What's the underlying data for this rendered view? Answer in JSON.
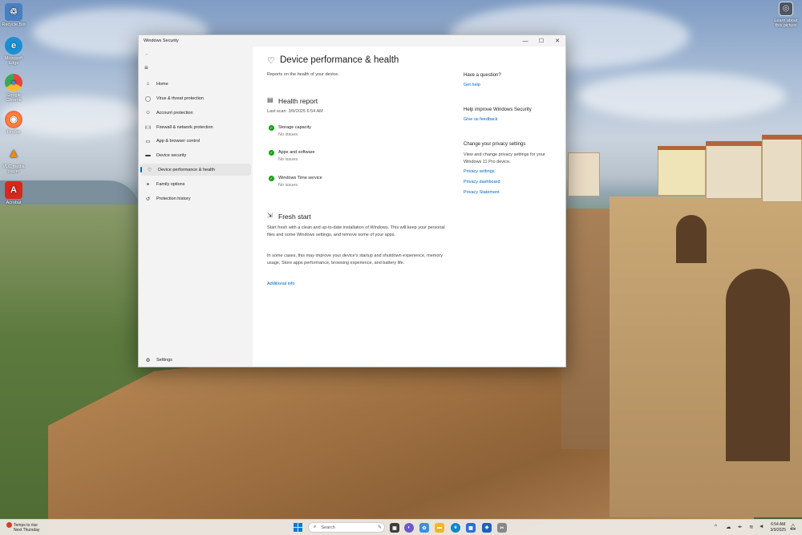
{
  "desktop": {
    "icons": [
      {
        "label": "Recycle Bin",
        "glyph": "♲",
        "color": "#4a7fbf"
      },
      {
        "label": "Microsoft Edge",
        "glyph": "e",
        "color": "#1b8fd3"
      },
      {
        "label": "Google Chrome",
        "glyph": "●",
        "color": "#e8453c"
      },
      {
        "label": "Firefox",
        "glyph": "◉",
        "color": "#ff7139"
      },
      {
        "label": "VLC media player",
        "glyph": "▲",
        "color": "#f08a00"
      },
      {
        "label": "Acrobat",
        "glyph": "A",
        "color": "#d9271c"
      }
    ],
    "about_picture": {
      "label": "Learn about this picture",
      "icon": "camera-icon"
    }
  },
  "window": {
    "title": "Windows Security",
    "controls": {
      "minimize": "—",
      "maximize": "☐",
      "close": "✕"
    }
  },
  "sidebar": {
    "back": "←",
    "menu": "≡",
    "items": [
      {
        "label": "Home",
        "icon": "⌂"
      },
      {
        "label": "Virus & threat protection",
        "icon": "◯"
      },
      {
        "label": "Account protection",
        "icon": "☺"
      },
      {
        "label": "Firewall & network protection",
        "icon": "((·))"
      },
      {
        "label": "App & browser control",
        "icon": "▭"
      },
      {
        "label": "Device security",
        "icon": "▬"
      },
      {
        "label": "Device performance & health",
        "icon": "♡"
      },
      {
        "label": "Family options",
        "icon": "⚭"
      },
      {
        "label": "Protection history",
        "icon": "↺"
      }
    ],
    "active_index": 6,
    "settings": {
      "label": "Settings",
      "icon": "⚙"
    }
  },
  "main": {
    "title": "Device performance & health",
    "subtitle": "Reports on the health of your device.",
    "health_report": {
      "title": "Health report",
      "last_scan": "Last scan: 3/9/2025 6:54 AM",
      "items": [
        {
          "title": "Storage capacity",
          "status": "No issues"
        },
        {
          "title": "Apps and software",
          "status": "No issues"
        },
        {
          "title": "Windows Time service",
          "status": "No issues"
        }
      ]
    },
    "fresh_start": {
      "title": "Fresh start",
      "para1": "Start fresh with a clean and up-to-date installation of Windows. This will keep your personal files and some Windows settings, and remove some of your apps.",
      "para2": "In some cases, this may improve your device's startup and shutdown experience, memory usage, Store apps performance, browsing experience, and battery life.",
      "link": "Additional info"
    }
  },
  "right_panel": {
    "question": {
      "heading": "Have a question?",
      "link": "Get help"
    },
    "improve": {
      "heading": "Help improve Windows Security",
      "link": "Give us feedback"
    },
    "privacy": {
      "heading": "Change your privacy settings",
      "text": "View and change privacy settings for your Windows 11 Pro device.",
      "links": [
        "Privacy settings",
        "Privacy dashboard",
        "Privacy Statement"
      ]
    }
  },
  "taskbar": {
    "weather_line1": "Temps to rise",
    "weather_line2": "Next Thursday",
    "search_placeholder": "Search",
    "apps": [
      {
        "name": "task-view",
        "glyph": "▣",
        "color": "#3d3d3d"
      },
      {
        "name": "copilot",
        "glyph": "◐",
        "color": "#6a5acd"
      },
      {
        "name": "photos",
        "glyph": "✿",
        "color": "#3e8ee0"
      },
      {
        "name": "file-explorer",
        "glyph": "▬",
        "color": "#f2b624"
      },
      {
        "name": "edge",
        "glyph": "e",
        "color": "#0f86c9"
      },
      {
        "name": "store",
        "glyph": "▦",
        "color": "#2a6fd6"
      },
      {
        "name": "windows-security",
        "glyph": "◈",
        "color": "#1f5fbf"
      }
    ],
    "time": "6:54 AM",
    "date": "3/9/2025"
  },
  "colors": {
    "accent": "#0067c0",
    "ok": "#13a10e"
  }
}
